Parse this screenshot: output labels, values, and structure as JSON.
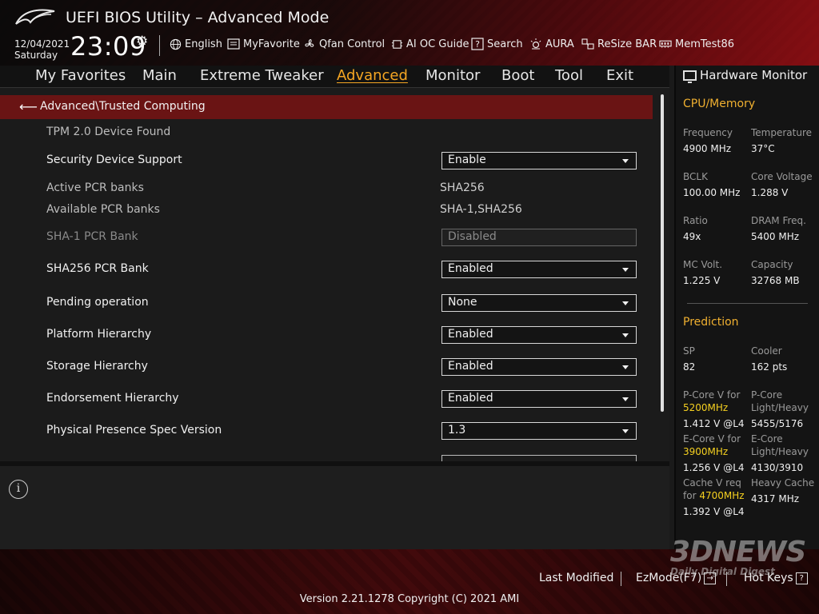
{
  "header": {
    "app_title": "UEFI BIOS Utility – Advanced Mode",
    "date": "12/04/2021",
    "day": "Saturday",
    "time": "23:09",
    "toolbar": [
      {
        "label": "English",
        "icon": "globe-icon"
      },
      {
        "label": "MyFavorite",
        "icon": "favorite-list-icon"
      },
      {
        "label": "Qfan Control",
        "icon": "fan-icon"
      },
      {
        "label": "AI OC Guide",
        "icon": "chip-icon"
      },
      {
        "label": "Search",
        "icon": "help-search-icon"
      },
      {
        "label": "AURA",
        "icon": "light-bulb-icon"
      },
      {
        "label": "ReSize BAR",
        "icon": "resize-bar-icon"
      },
      {
        "label": "MemTest86",
        "icon": "memory-icon"
      }
    ]
  },
  "menu": [
    "My Favorites",
    "Main",
    "Extreme Tweaker",
    "Advanced",
    "Monitor",
    "Boot",
    "Tool",
    "Exit"
  ],
  "active_menu": "Advanced",
  "breadcrumb": "Advanced\\Trusted Computing",
  "settings": {
    "tpm_found": "TPM 2.0 Device Found",
    "security_device_support": {
      "label": "Security Device Support",
      "value": "Enable"
    },
    "active_pcr_banks": {
      "label": "Active PCR banks",
      "value": "SHA256"
    },
    "available_pcr_banks": {
      "label": "Available PCR banks",
      "value": "SHA-1,SHA256"
    },
    "sha1_pcr_bank": {
      "label": "SHA-1 PCR Bank",
      "value": "Disabled"
    },
    "sha256_pcr_bank": {
      "label": "SHA256 PCR Bank",
      "value": "Enabled"
    },
    "pending_operation": {
      "label": "Pending operation",
      "value": "None"
    },
    "platform_hierarchy": {
      "label": "Platform Hierarchy",
      "value": "Enabled"
    },
    "storage_hierarchy": {
      "label": "Storage Hierarchy",
      "value": "Enabled"
    },
    "endorsement_hierarchy": {
      "label": "Endorsement Hierarchy",
      "value": "Enabled"
    },
    "physical_presence_spec": {
      "label": "Physical Presence Spec Version",
      "value": "1.3"
    }
  },
  "hardware_monitor": {
    "title": "Hardware Monitor",
    "cpu_memory": {
      "section": "CPU/Memory",
      "frequency": {
        "label": "Frequency",
        "value": "4900 MHz"
      },
      "temperature": {
        "label": "Temperature",
        "value": "37°C"
      },
      "bclk": {
        "label": "BCLK",
        "value": "100.00 MHz"
      },
      "core_voltage": {
        "label": "Core Voltage",
        "value": "1.288 V"
      },
      "ratio": {
        "label": "Ratio",
        "value": "49x"
      },
      "dram_freq": {
        "label": "DRAM Freq.",
        "value": "5400 MHz"
      },
      "mc_volt": {
        "label": "MC Volt.",
        "value": "1.225 V"
      },
      "capacity": {
        "label": "Capacity",
        "value": "32768 MB"
      }
    },
    "prediction": {
      "section": "Prediction",
      "sp": {
        "label": "SP",
        "value": "82"
      },
      "cooler": {
        "label": "Cooler",
        "value": "162 pts"
      },
      "pcore_v": {
        "label": "P-Core V for",
        "freq": "5200MHz",
        "value": "1.412 V @L4"
      },
      "pcore_lh": {
        "label1": "P-Core",
        "label2": "Light/Heavy",
        "value": "5455/5176"
      },
      "ecore_v": {
        "label": "E-Core V for",
        "freq": "3900MHz",
        "value": "1.256 V @L4"
      },
      "ecore_lh": {
        "label1": "E-Core",
        "label2": "Light/Heavy",
        "value": "4130/3910"
      },
      "cache_v": {
        "label1": "Cache V req",
        "label2": "for",
        "freq": "4700MHz",
        "value": "1.392 V @L4"
      },
      "heavy_cache": {
        "label": "Heavy Cache",
        "value": "4317 MHz"
      }
    }
  },
  "footer": {
    "last_modified": "Last Modified",
    "ezmode": "EzMode(F7)",
    "hot_keys": "Hot Keys",
    "hot_keys_key": "?",
    "copyright": "Version 2.21.1278 Copyright (C) 2021 AMI"
  },
  "watermark": {
    "big": "3DNEWS",
    "small": "Daily Digital Digest"
  },
  "colors": {
    "accent": "#f5a623",
    "breadcrumb_bg": "#6a1414",
    "highlight": "#f5d020"
  }
}
